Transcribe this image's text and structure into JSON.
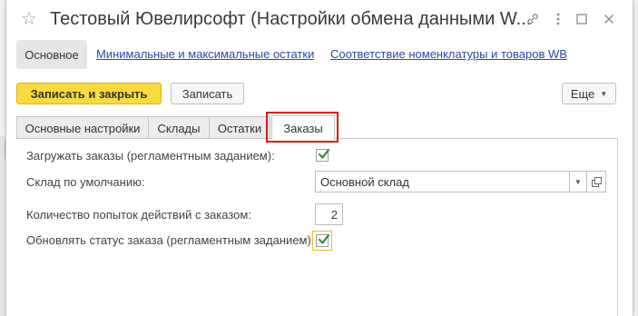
{
  "window": {
    "title": "Тестовый Ювелирсофт (Настройки обмена данными W...",
    "favorite_icon": "star-icon",
    "controls": [
      "link-icon",
      "more-vertical-icon",
      "maximize-icon",
      "close-icon"
    ]
  },
  "nav": {
    "active": "Основное",
    "links": [
      "Минимальные и максимальные остатки",
      "Соответствие номенклатуры и товаров WB"
    ]
  },
  "toolbar": {
    "save_close": "Записать и закрыть",
    "save": "Записать",
    "more": "Еще",
    "more_icon": "chevron-down-icon"
  },
  "tabs": {
    "items": [
      "Основные настройки",
      "Склады",
      "Остатки",
      "Заказы"
    ],
    "active": "Заказы"
  },
  "form": {
    "load_orders": {
      "label": "Загружать заказы (регламентным заданием):",
      "checked": true
    },
    "default_warehouse": {
      "label": "Склад по умолчанию:",
      "value": "Основной склад"
    },
    "attempts": {
      "label": "Количество попыток действий с заказом:",
      "value": "2"
    },
    "update_status": {
      "label": "Обновлять статус заказа (регламентным заданием):",
      "checked": true
    }
  },
  "colors": {
    "primary_button": "#fadb3e",
    "highlight": "#e31818",
    "check": "#2e8b3c"
  }
}
